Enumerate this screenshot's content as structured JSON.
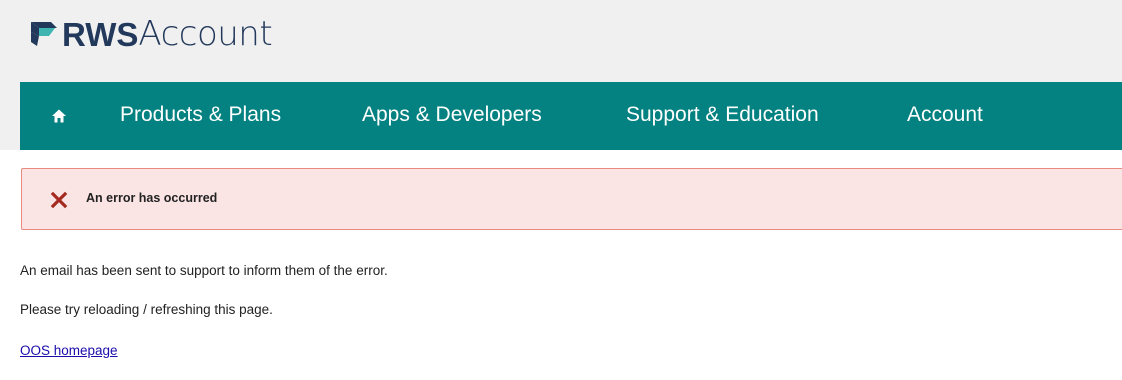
{
  "brand": {
    "name_bold": "RWS",
    "name_light": "Account",
    "colors": {
      "navy": "#23395b",
      "teal": "#3fb4b0"
    }
  },
  "nav": {
    "background": "#048181",
    "home_icon": "home-icon",
    "items": [
      {
        "label": "Products & Plans"
      },
      {
        "label": "Apps & Developers"
      },
      {
        "label": "Support & Education"
      },
      {
        "label": "Account"
      }
    ]
  },
  "alert": {
    "icon": "close-icon",
    "icon_color": "#a42a1f",
    "title": "An error has occurred"
  },
  "messages": {
    "line1": "An email has been sent to support to inform them of the error.",
    "line2": "Please try reloading / refreshing this page."
  },
  "link": {
    "label": "OOS homepage"
  }
}
